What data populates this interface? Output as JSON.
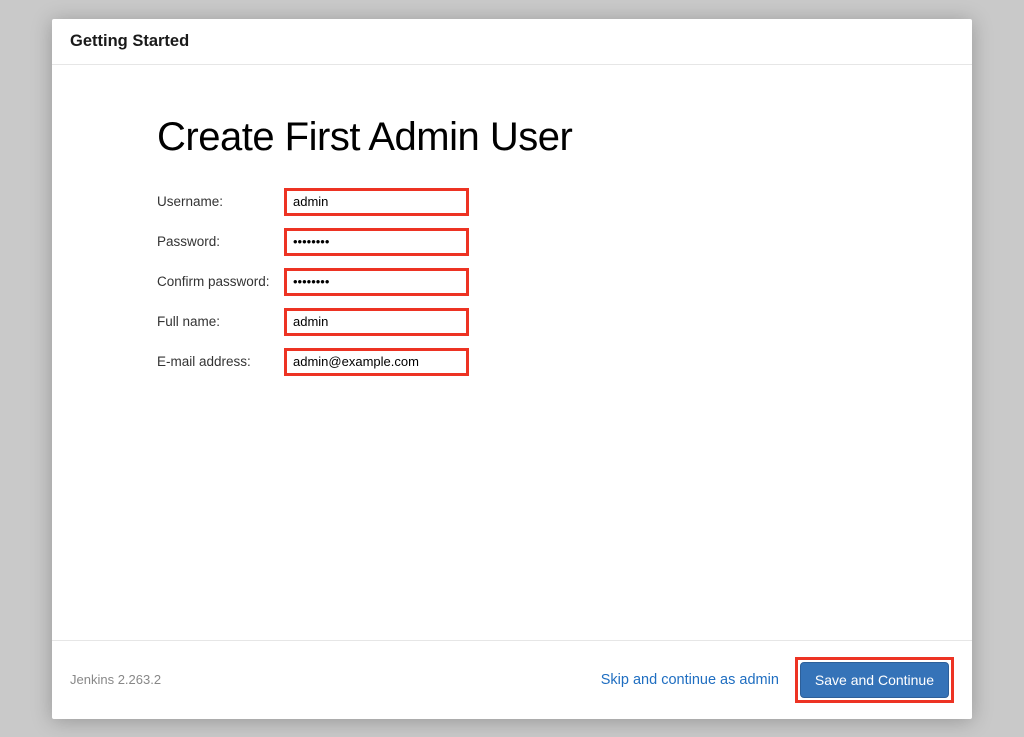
{
  "header": {
    "title": "Getting Started"
  },
  "main": {
    "heading": "Create First Admin User",
    "fields": {
      "username": {
        "label": "Username:",
        "value": "admin"
      },
      "password": {
        "label": "Password:",
        "value": "••••••••"
      },
      "confirm_password": {
        "label": "Confirm password:",
        "value": "••••••••"
      },
      "fullname": {
        "label": "Full name:",
        "value": "admin"
      },
      "email": {
        "label": "E-mail address:",
        "value": "admin@example.com"
      }
    }
  },
  "footer": {
    "version": "Jenkins 2.263.2",
    "skip_label": "Skip and continue as admin",
    "save_label": "Save and Continue"
  },
  "colors": {
    "highlight": "#ed3323",
    "primary": "#3573b8",
    "link": "#1f6ec1"
  }
}
